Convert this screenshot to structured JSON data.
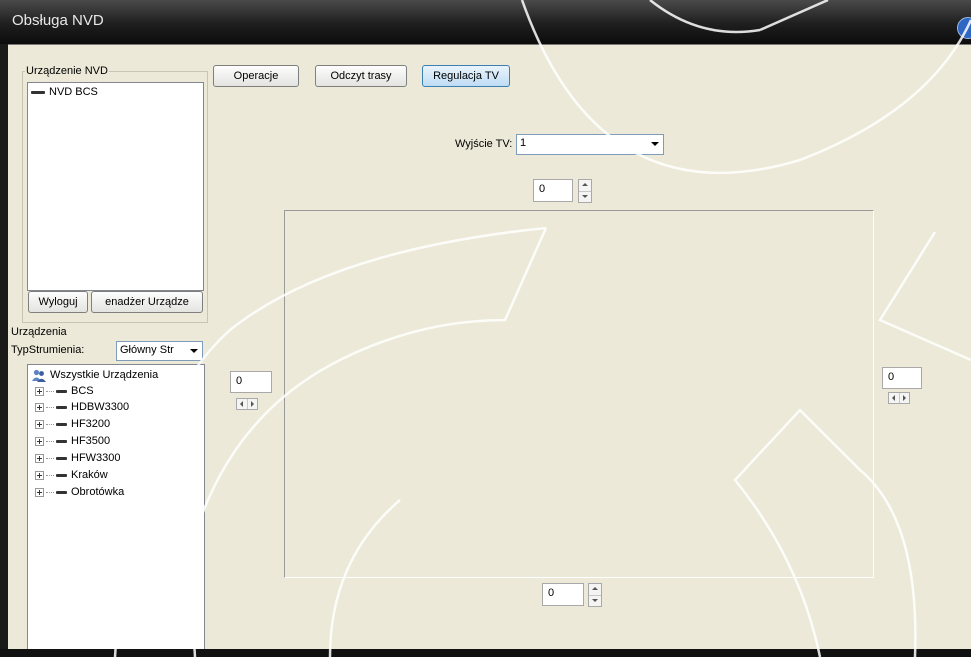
{
  "window": {
    "title": "Obsługa NVD"
  },
  "nvd_group": {
    "label": "Urządzenie NVD",
    "items": [
      "NVD BCS"
    ],
    "logout_label": "Wyloguj",
    "device_manager_label": "enadżer Urządze"
  },
  "devices_group": {
    "label": "Urządzenia",
    "stream_type_label": "TypStrumienia:",
    "stream_type_value": "Główny Str",
    "tree_root": "Wszystkie Urządzenia",
    "tree_items": [
      "BCS",
      "HDBW3300",
      "HF3200",
      "HF3500",
      "HFW3300",
      "Kraków",
      "Obrotówka"
    ]
  },
  "tabs": {
    "operations": "Operacje",
    "route_read": "Odczyt trasy",
    "tv_adjust": "Regulacja TV"
  },
  "tv": {
    "output_label": "Wyjście TV:",
    "output_value": "1",
    "top_offset": "0",
    "left_offset": "0",
    "right_offset": "0",
    "bottom_offset": "0"
  },
  "icons": {
    "close": "close-icon",
    "device": "device-icon",
    "group": "users-group-icon",
    "expand": "plus-expand-icon"
  }
}
